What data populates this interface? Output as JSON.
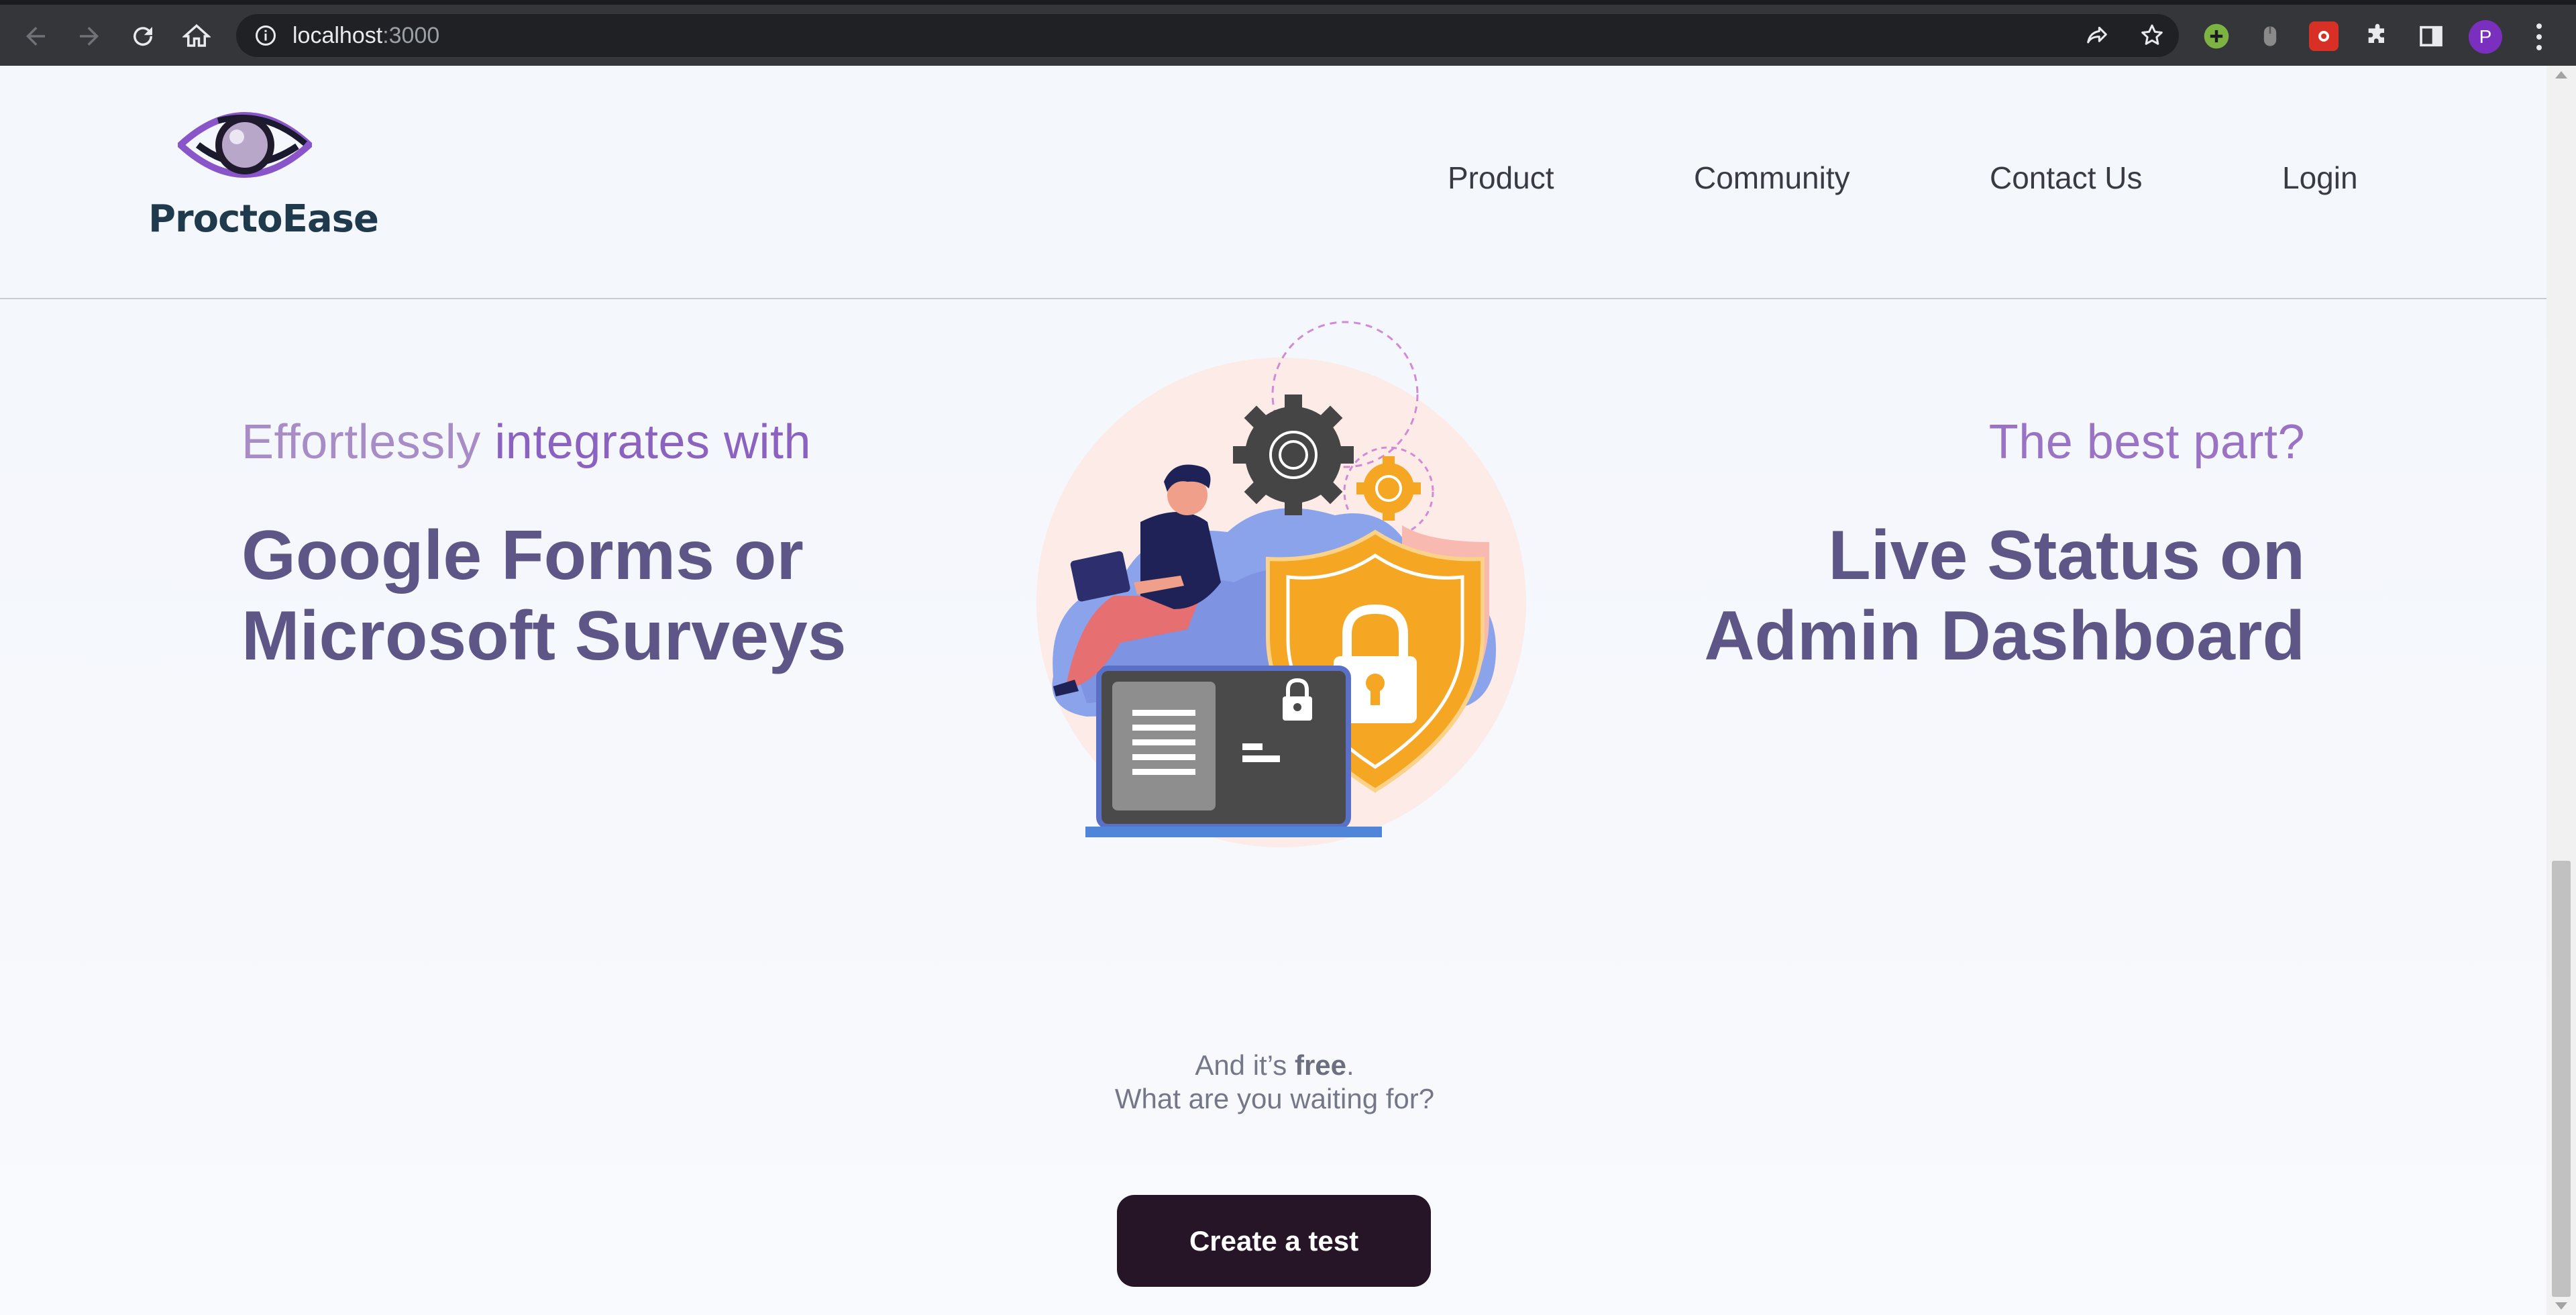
{
  "browser": {
    "url_host": "localhost",
    "url_port": ":3000",
    "profile_initial": "P",
    "icons": [
      "back-arrow-icon",
      "forward-arrow-icon",
      "reload-icon",
      "home-icon",
      "info-icon",
      "share-icon",
      "bookmark-star-icon",
      "extensions-puzzle-icon",
      "side-panel-icon",
      "menu-kebab-icon"
    ]
  },
  "header": {
    "brand": "ProctoEase",
    "nav": {
      "product": "Product",
      "community": "Community",
      "contact": "Contact Us",
      "login": "Login"
    }
  },
  "hero": {
    "left": {
      "tagline_part1": "Effortlessly",
      "tagline_part2": "integrates with",
      "headline_line1": "Google Forms or",
      "headline_line2": "Microsoft Surveys"
    },
    "right": {
      "tagline": "The best part?",
      "headline_line1": "Live Status on",
      "headline_line2": "Admin Dashboard"
    }
  },
  "cta": {
    "line1_prefix": "And it’s ",
    "line1_bold": "free",
    "line1_suffix": ".",
    "line2": "What are you waiting for?",
    "button_label": "Create a test"
  },
  "colors": {
    "accent_purple": "#8c62c0",
    "headline": "#5e5687",
    "button_bg": "#251526",
    "shield_orange": "#f5a623"
  }
}
